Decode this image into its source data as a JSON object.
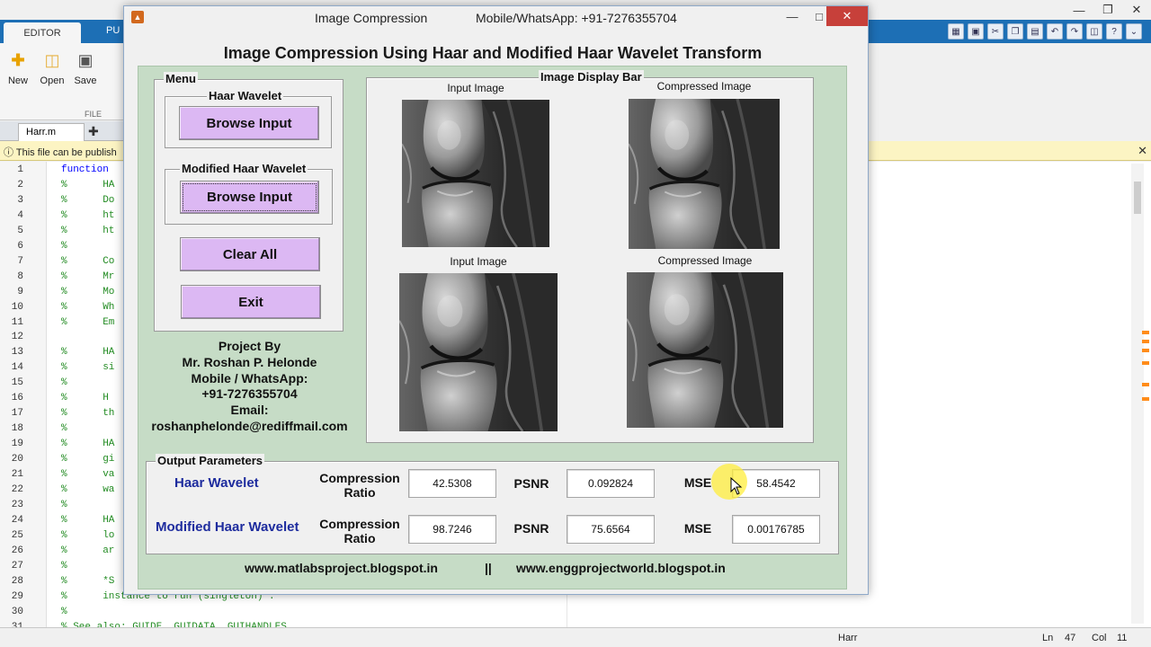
{
  "matlab": {
    "ribbon_tabs": [
      "EDITOR",
      "PU"
    ],
    "ribbon_buttons": [
      {
        "label": "New",
        "icon": "new-plus-icon"
      },
      {
        "label": "Open",
        "icon": "folder-icon"
      },
      {
        "label": "Save",
        "icon": "save-disk-icon"
      }
    ],
    "file_section_label": "FILE",
    "doc_tab": "Harr.m",
    "info_bar": "This file can be publish",
    "code_lines": [
      {
        "n": "1",
        "text": "function"
      },
      {
        "n": "2",
        "text": "%      HA"
      },
      {
        "n": "3",
        "text": "%      Do"
      },
      {
        "n": "4",
        "text": "%      ht"
      },
      {
        "n": "5",
        "text": "%      ht"
      },
      {
        "n": "6",
        "text": "%"
      },
      {
        "n": "7",
        "text": "%      Co"
      },
      {
        "n": "8",
        "text": "%      Mr"
      },
      {
        "n": "9",
        "text": "%      Mo"
      },
      {
        "n": "10",
        "text": "%      Wh"
      },
      {
        "n": "11",
        "text": "%      Em"
      },
      {
        "n": "12",
        "text": ""
      },
      {
        "n": "13",
        "text": "%      HA"
      },
      {
        "n": "14",
        "text": "%      si"
      },
      {
        "n": "15",
        "text": "%"
      },
      {
        "n": "16",
        "text": "%      H"
      },
      {
        "n": "17",
        "text": "%      th"
      },
      {
        "n": "18",
        "text": "%"
      },
      {
        "n": "19",
        "text": "%      HA"
      },
      {
        "n": "20",
        "text": "%      gi"
      },
      {
        "n": "21",
        "text": "%      va"
      },
      {
        "n": "22",
        "text": "%      wa"
      },
      {
        "n": "23",
        "text": "%"
      },
      {
        "n": "24",
        "text": "%      HA"
      },
      {
        "n": "25",
        "text": "%      lo"
      },
      {
        "n": "26",
        "text": "%      ar"
      },
      {
        "n": "27",
        "text": "%"
      },
      {
        "n": "28",
        "text": "%      *S"
      },
      {
        "n": "29",
        "text": "%      instance to run (singleton)\"."
      },
      {
        "n": "30",
        "text": "%"
      },
      {
        "n": "31",
        "text": "% See also: GUIDE, GUIDATA, GUIHANDLES"
      }
    ],
    "status": {
      "file": "Harr",
      "ln_label": "Ln",
      "ln": "47",
      "col_label": "Col",
      "col": "11"
    }
  },
  "figure": {
    "window_title": "Image Compression",
    "window_subtitle": "Mobile/WhatsApp: +91-7276355704",
    "main_title": "Image Compression Using Haar and Modified Haar Wavelet Transform",
    "menu": {
      "title": "Menu",
      "haar_panel_title": "Haar Wavelet",
      "haar_browse": "Browse Input",
      "modified_panel_title": "Modified Haar Wavelet",
      "modified_browse": "Browse Input",
      "clear_all": "Clear All",
      "exit": "Exit"
    },
    "credits": {
      "line1": "Project By",
      "line2": "Mr. Roshan P. Helonde",
      "line3": "Mobile / WhatsApp:",
      "line4": "+91-7276355704",
      "line5": "Email:",
      "line6": "roshanphelonde@rediffmail.com"
    },
    "display": {
      "title": "Image Display Bar",
      "top_left_label": "Input Image",
      "top_right_label": "Compressed Image",
      "bottom_left_label": "Input Image",
      "bottom_right_label": "Compressed Image"
    },
    "output": {
      "title": "Output Parameters",
      "cr_label_1": "Compression",
      "cr_label_2": "Ratio",
      "psnr_label": "PSNR",
      "mse_label": "MSE",
      "rows": [
        {
          "name": "Haar Wavelet",
          "compression_ratio": "42.5308",
          "psnr": "0.092824",
          "mse": "58.4542"
        },
        {
          "name": "Modified Haar Wavelet",
          "compression_ratio": "98.7246",
          "psnr": "75.6564",
          "mse": "0.00176785"
        }
      ]
    },
    "footer": {
      "left": "www.matlabsproject.blogspot.in",
      "sep": "||",
      "right": "www.enggprojectworld.blogspot.in"
    }
  },
  "colors": {
    "button_purple": "#dcb8f3",
    "panel_green": "#c6dcc6",
    "row_label_blue": "#1e2c9e",
    "ribbon_blue": "#1d6fb5",
    "close_red": "#c7403a"
  }
}
